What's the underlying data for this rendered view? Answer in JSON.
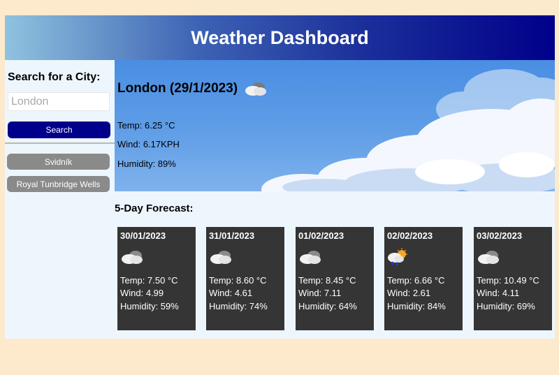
{
  "header": {
    "title": "Weather Dashboard"
  },
  "sidebar": {
    "search_title": "Search for a City:",
    "search_placeholder": "London",
    "search_button": "Search",
    "history": [
      {
        "label": "Svidník"
      },
      {
        "label": "Royal Tunbridge Wells"
      }
    ]
  },
  "current": {
    "title": "London (29/1/2023)",
    "icon": "cloudy-icon",
    "temp": "Temp: 6.25 °C",
    "wind": "Wind: 6.17KPH",
    "humidity": "Humidity: 89%"
  },
  "forecast": {
    "title": "5-Day Forecast:",
    "days": [
      {
        "date": "30/01/2023",
        "icon": "cloudy-icon",
        "temp": "Temp: 7.50 °C",
        "wind": "Wind: 4.99",
        "humidity": "Humidity: 59%"
      },
      {
        "date": "31/01/2023",
        "icon": "cloudy-icon",
        "temp": "Temp: 8.60 °C",
        "wind": "Wind: 4.61",
        "humidity": "Humidity: 74%"
      },
      {
        "date": "01/02/2023",
        "icon": "cloudy-icon",
        "temp": "Temp: 8.45 °C",
        "wind": "Wind: 7.11",
        "humidity": "Humidity: 64%"
      },
      {
        "date": "02/02/2023",
        "icon": "rain-sun-icon",
        "temp": "Temp: 6.66 °C",
        "wind": "Wind: 2.61",
        "humidity": "Humidity: 84%"
      },
      {
        "date": "03/02/2023",
        "icon": "cloudy-icon",
        "temp": "Temp: 10.49 °C",
        "wind": "Wind: 4.11",
        "humidity": "Humidity: 69%"
      }
    ]
  },
  "colors": {
    "page_bg": "#fde9cc",
    "app_bg": "#eef6fd",
    "header_accent": "#00008a",
    "search_button": "#00008a",
    "history_button": "#8a8a8a",
    "card_bg": "#353535"
  }
}
